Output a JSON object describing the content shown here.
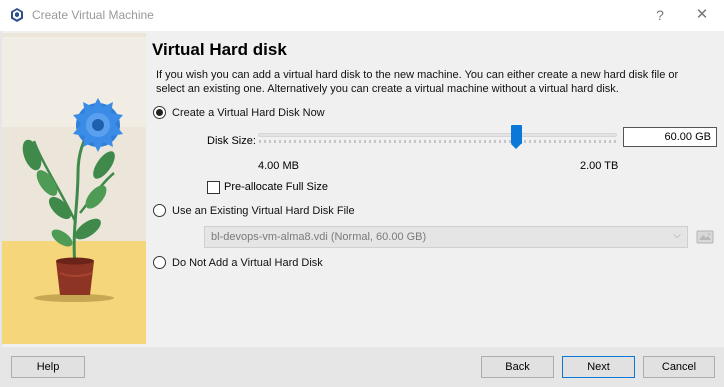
{
  "window": {
    "title": "Create Virtual Machine",
    "help_glyph": "?",
    "close_glyph": "✕"
  },
  "page": {
    "heading": "Virtual Hard disk",
    "description": "If you wish you can add a virtual hard disk to the new machine. You can either create a new hard disk file or select an existing one. Alternatively you can create a virtual machine without a virtual hard disk."
  },
  "options": {
    "create_now": {
      "label": "Create a Virtual Hard Disk Now",
      "selected": true
    },
    "use_existing": {
      "label": "Use an Existing Virtual Hard Disk File",
      "selected": false
    },
    "no_disk": {
      "label": "Do Not Add a Virtual Hard Disk",
      "selected": false
    }
  },
  "disk_size": {
    "label": "Disk Size:",
    "value": "60.00 GB",
    "min_label": "4.00 MB",
    "max_label": "2.00 TB",
    "slider_fraction": 0.72
  },
  "preallocate": {
    "label": "Pre-allocate Full Size",
    "checked": false
  },
  "existing_file": {
    "selected_value": "bl-devops-vm-alma8.vdi (Normal, 60.00 GB)"
  },
  "buttons": {
    "help": "Help",
    "back": "Back",
    "next": "Next",
    "cancel": "Cancel"
  },
  "colors": {
    "accent": "#0a78d7",
    "window_bg": "#f0f0f0",
    "footer_bg": "#e6e6e6",
    "illustration_wall": "#ece6da",
    "illustration_floor": "#f5d67a",
    "flower_blue": "#2f7ed8",
    "leaf_green": "#3f8a4a",
    "pot_red": "#8e3424"
  }
}
